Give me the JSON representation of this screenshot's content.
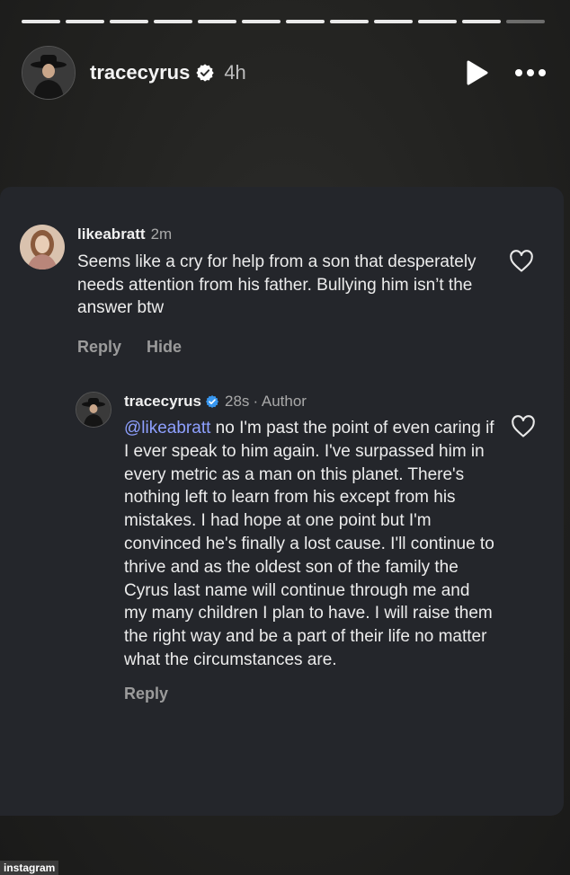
{
  "story": {
    "progress_segments_total": 12,
    "progress_segments_viewed": 11,
    "author": "tracecyrus",
    "age": "4h",
    "verified": true,
    "controls": {
      "play_icon": "play-icon",
      "more_icon": "more-horizontal-icon"
    }
  },
  "comments": {
    "first": {
      "username": "likeabratt",
      "age": "2m",
      "text": "Seems like a cry for help from a son that desperately needs attention from his father. Bullying him isn’t the answer btw",
      "actions": {
        "reply": "Reply",
        "hide": "Hide"
      }
    },
    "reply": {
      "username": "tracecyrus",
      "verified": true,
      "age": "28s",
      "author_tag": "· Author",
      "mention": "@likeabratt",
      "text": " no I'm past the point of even caring if I ever speak to him again. I've surpassed him in every metric as a man on this planet. There's nothing left to learn from his except from his mistakes. I had hope at one point but I'm convinced he's finally a lost cause. I'll continue to thrive and as the oldest son of the family the Cyrus last name will continue through me and my many children I plan to have. I will raise them the right way and be a part of their life no matter what the circumstances are.",
      "actions": {
        "reply": "Reply"
      }
    }
  },
  "watermark": "instagram",
  "colors": {
    "card": "#24262b",
    "mention": "#8ea0ff",
    "verified": "#ffffff"
  }
}
